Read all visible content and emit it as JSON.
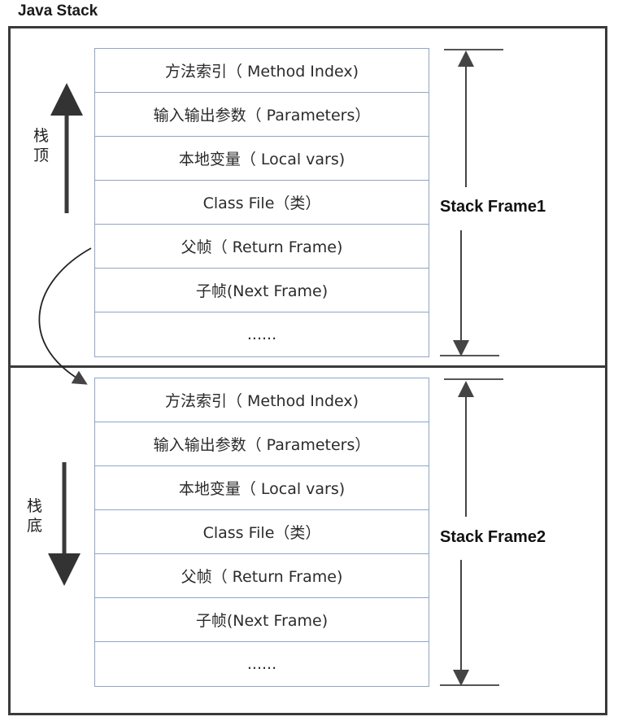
{
  "title": "Java Stack",
  "frames": [
    {
      "label": "Stack Frame1",
      "rows": [
        "方法索引（ Method Index)",
        "输入输出参数（ Parameters）",
        "本地变量（ Local vars)",
        "Class File（类）",
        "父帧（ Return Frame)",
        "子帧(Next Frame)",
        "......"
      ]
    },
    {
      "label": "Stack Frame2",
      "rows": [
        "方法索引（ Method Index)",
        "输入输出参数（ Parameters）",
        "本地变量（ Local vars)",
        "Class File（类）",
        "父帧（ Return Frame)",
        "子帧(Next Frame)",
        "......"
      ]
    }
  ],
  "side_labels": {
    "top": "栈顶",
    "bottom": "栈底"
  },
  "arrows": {
    "top_direction": "up",
    "bottom_direction": "down",
    "link": "Return Frame of Frame1 → Method Index of Frame2"
  },
  "colors": {
    "table_border": "#8ea6c8",
    "frame_border": "#3a3a3a",
    "arrow": "#444444"
  }
}
